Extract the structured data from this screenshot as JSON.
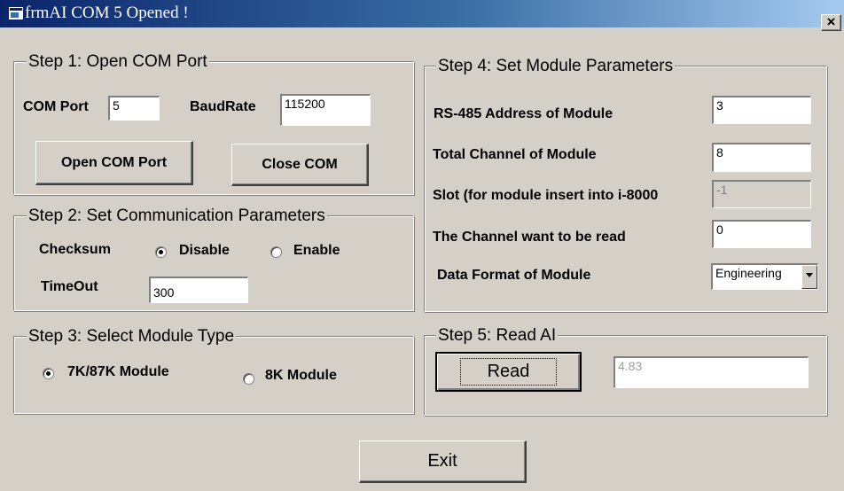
{
  "window": {
    "title": "frmAI COM  5 Opened !",
    "close_glyph": "×"
  },
  "step1": {
    "legend": "Step 1: Open COM Port",
    "com_port_label": "COM Port",
    "com_port_value": "5",
    "baudrate_label": "BaudRate",
    "baudrate_value": "115200",
    "open_button": "Open COM Port",
    "close_button": "Close COM"
  },
  "step2": {
    "legend": "Step 2: Set Communication Parameters",
    "checksum_label": "Checksum",
    "disable_label": "Disable",
    "enable_label": "Enable",
    "timeout_label": "TimeOut",
    "timeout_value": "300"
  },
  "step3": {
    "legend": "Step 3: Select Module Type",
    "option_7k": "7K/87K Module",
    "option_8k": "8K Module"
  },
  "step4": {
    "legend": "Step 4: Set Module Parameters",
    "address_label": "RS-485 Address of Module",
    "address_value": "3",
    "channels_label": "Total Channel of Module",
    "channels_value": "8",
    "slot_label": "Slot (for module insert into i-8000",
    "slot_value": "-1",
    "read_channel_label": "The Channel want to be read",
    "read_channel_value": "0",
    "format_label": "Data Format of Module",
    "format_value": "Engineering"
  },
  "step5": {
    "legend": "Step 5: Read AI",
    "read_button": "Read",
    "result_value": "4.83"
  },
  "exit_button": "Exit"
}
